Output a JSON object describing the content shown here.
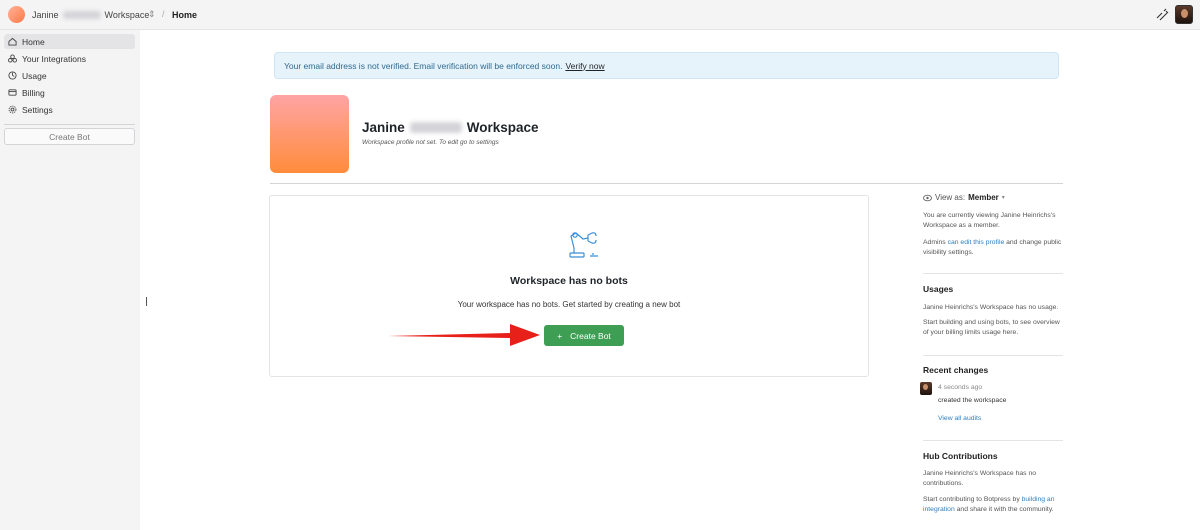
{
  "topbar": {
    "workspace_first": "Janine",
    "workspace_last": "Workspace",
    "breadcrumb": "Home"
  },
  "sidebar": {
    "items": [
      {
        "label": "Home",
        "icon": "home-icon"
      },
      {
        "label": "Your Integrations",
        "icon": "integrations-icon"
      },
      {
        "label": "Usage",
        "icon": "usage-icon"
      },
      {
        "label": "Billing",
        "icon": "billing-icon"
      },
      {
        "label": "Settings",
        "icon": "settings-icon"
      }
    ],
    "create_bot": "Create Bot"
  },
  "banner": {
    "text": "Your email address is not verified. Email verification will be enforced soon.",
    "link": "Verify now"
  },
  "workspace": {
    "title_first": "Janine",
    "title_last": "Workspace",
    "subtitle": "Workspace profile not set. To edit go to settings"
  },
  "empty": {
    "title": "Workspace has no bots",
    "desc": "Your workspace has no bots. Get started by creating a new bot",
    "button": "Create Bot"
  },
  "right": {
    "view_as_label": "View as:",
    "view_as_value": "Member",
    "viewing_text": "You are currently viewing Janine Heinrichs's Workspace as a member.",
    "admins_pre": "Admins",
    "admins_link": "can edit this profile",
    "admins_post": "and change public visibility settings.",
    "usages_title": "Usages",
    "usages_text": "Janine Heinrichs's Workspace has no usage.",
    "usages_text2": "Start building and using bots, to see overview of your billing limits usage here.",
    "changes_title": "Recent changes",
    "change_time": "4 seconds ago",
    "change_text": "created the workspace",
    "audits_link": "View all audits",
    "hub_title": "Hub Contributions",
    "hub_text": "Janine Heinrichs's Workspace has no contributions.",
    "hub_pre": "Start contributing to Botpress by",
    "hub_link": "building an integration",
    "hub_post": "and share it with the community."
  },
  "colors": {
    "primary_button": "#3e9e53",
    "banner_bg": "#e6f3fb",
    "link": "#2d7fc2",
    "arrow": "#e8201a"
  }
}
